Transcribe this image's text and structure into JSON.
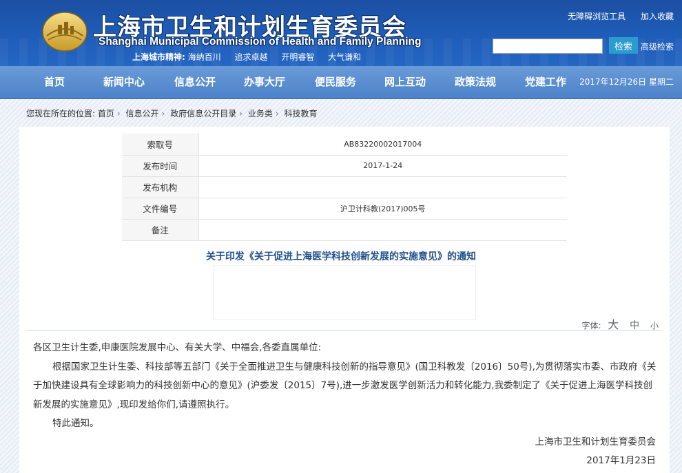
{
  "header": {
    "title_cn": "上海市卫生和计划生育委员会",
    "title_en": "Shanghai Municipal Commission of Health and Family Planning",
    "spirit_label": "上海城市精神:",
    "spirit_items": [
      "海纳百川",
      "追求卓越",
      "开明睿智",
      "大气谦和"
    ],
    "top_links": [
      "无障碍浏览工具",
      "加入收藏"
    ],
    "search_button": "检索",
    "advanced_search": "高级检索",
    "search_value": ""
  },
  "nav": {
    "items": [
      "首页",
      "新闻中心",
      "信息公开",
      "办事大厅",
      "便民服务",
      "网上互动",
      "政策法规",
      "党建工作"
    ],
    "date": "2017年12月26日 星期二"
  },
  "breadcrumb": {
    "prefix": "您现在所在的位置:",
    "items": [
      "首页",
      "信息公开",
      "政府信息公开目录",
      "业务类",
      "科技教育"
    ]
  },
  "meta": {
    "rows": [
      {
        "key": "索取号",
        "value": "AB83220002017004"
      },
      {
        "key": "发布时间",
        "value": "2017-1-24"
      },
      {
        "key": "发布机构",
        "value": ""
      },
      {
        "key": "文件编号",
        "value": "沪卫计科教(2017)005号"
      },
      {
        "key": "备注",
        "value": ""
      }
    ]
  },
  "document": {
    "title": "关于印发《关于促进上海医学科技创新发展的实施意见》的通知",
    "font_size_label": "字体:",
    "font_big": "大",
    "font_mid": "中",
    "font_small": "小",
    "salutation": "各区卫生计生委,申康医院发展中心、有关大学、中福会,各委直属单位:",
    "paragraph": "根据国家卫生计生委、科技部等五部门《关于全面推进卫生与健康科技创新的指导意见》(国卫科教发〔2016〕50号),为贯彻落实市委、市政府《关于加快建设具有全球影响力的科技创新中心的意见》(沪委发〔2015〕7号),进一步激发医学创新活力和转化能力,我委制定了《关于促进上海医学科技创新发展的实施意见》,现印发给你们,请遵照执行。",
    "closing": "特此通知。",
    "signature": "上海市卫生和计划生育委员会",
    "date": "2017年1月23日"
  },
  "colors": {
    "header_blue": "#1f5db8",
    "nav_blue": "#4c82c9",
    "title_blue": "#1f4e8c",
    "search_button": "#2b9bd0"
  }
}
